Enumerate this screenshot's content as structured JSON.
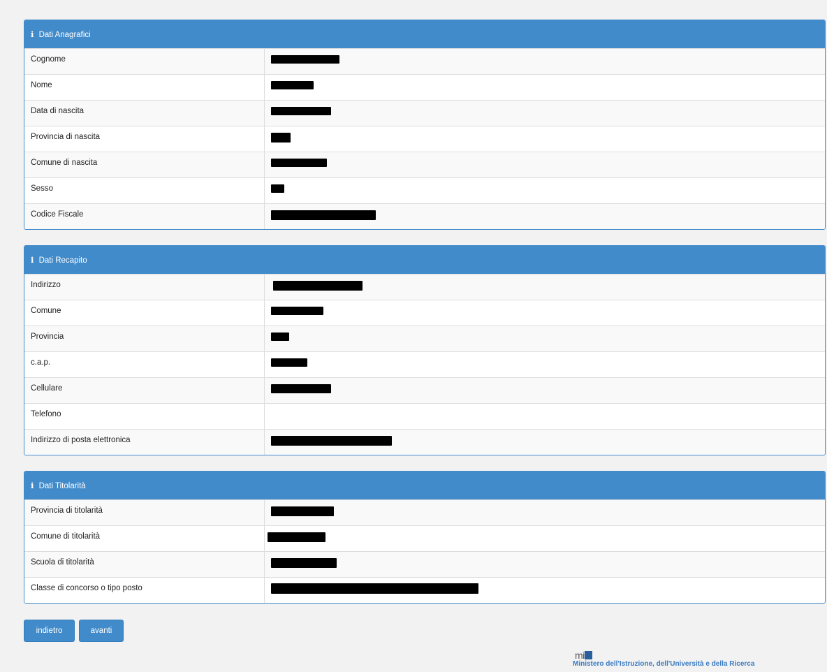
{
  "sections": [
    {
      "title": "Dati Anagrafici",
      "rows": [
        {
          "label": "Cognome"
        },
        {
          "label": "Nome"
        },
        {
          "label": "Data di nascita"
        },
        {
          "label": "Provincia di nascita"
        },
        {
          "label": "Comune di nascita"
        },
        {
          "label": "Sesso"
        },
        {
          "label": "Codice Fiscale"
        }
      ]
    },
    {
      "title": "Dati Recapito",
      "rows": [
        {
          "label": "Indirizzo"
        },
        {
          "label": "Comune"
        },
        {
          "label": "Provincia"
        },
        {
          "label": "c.a.p."
        },
        {
          "label": "Cellulare"
        },
        {
          "label": "Telefono"
        },
        {
          "label": "Indirizzo di posta elettronica"
        }
      ]
    },
    {
      "title": "Dati Titolarità",
      "rows": [
        {
          "label": "Provincia di titolarità"
        },
        {
          "label": "Comune di titolarità"
        },
        {
          "label": "Scuola di titolarità"
        },
        {
          "label": "Classe di concorso o tipo posto"
        }
      ]
    }
  ],
  "buttons": {
    "back_label": "indietro",
    "next_label": "avanti"
  },
  "footer": {
    "logo": "mi",
    "ministry": "Ministero dell'Istruzione, dell'Università e della Ricerca"
  },
  "icons": {
    "panel_heading_icon": "info-icon"
  },
  "colors": {
    "primary": "#428bca",
    "redaction": "#000000"
  }
}
